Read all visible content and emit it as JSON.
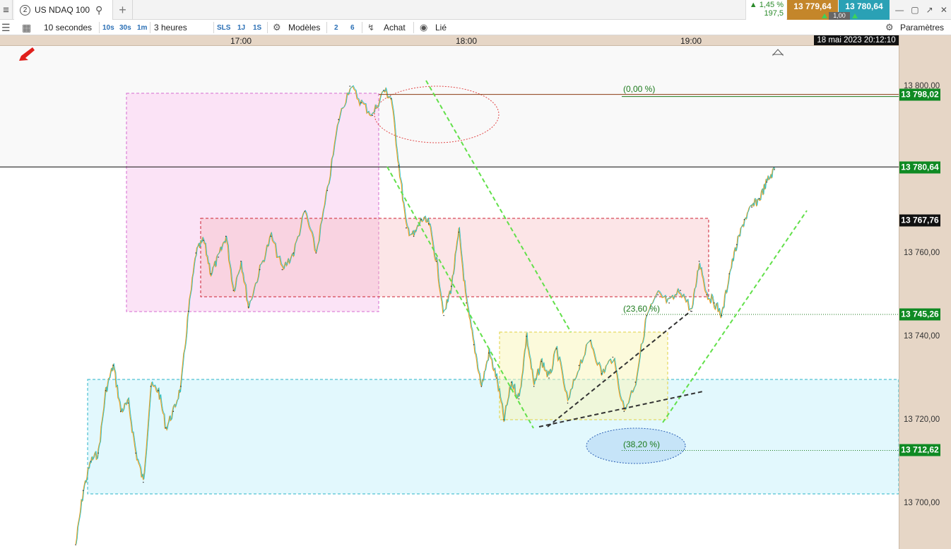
{
  "tab": {
    "badge": "2",
    "instrument": "US NDAQ 100",
    "add": "+"
  },
  "quote": {
    "change_pct": "▲ 1,45 %",
    "change_abs": "197,5",
    "bid": "13 779,64",
    "ask": "13 780,64",
    "spread": "1,00"
  },
  "toolbar": {
    "interval": "10 secondes",
    "i10s": "10s",
    "i30s": "30s",
    "i1m": "1m",
    "period": "3 heures",
    "sls": "SLS",
    "p1j": "1J",
    "p1s": "1S",
    "models": "Modèles",
    "n2": "2",
    "n6": "6",
    "buy": "Achat",
    "linked": "Lié",
    "settings": "Paramètres"
  },
  "time_axis": {
    "current": "18 mai 2023 20:12:10"
  },
  "colors": {
    "candles_up": "#1fc4d4",
    "candles_down": "#f0a020",
    "tag_green": "#0f8a23",
    "axis_bg": "#e6d6c6",
    "bid": "#c4862a",
    "ask": "#2aa1b5"
  },
  "chart_data": {
    "type": "line",
    "title": "US NDAQ 100",
    "xlabel": "",
    "ylabel": "",
    "x_ticks": [
      "17:00",
      "18:00",
      "19:00"
    ],
    "y_ticks": [
      "13 700,00",
      "13 720,00",
      "13 740,00",
      "13 760,00",
      "13 780,00",
      "13 800,00"
    ],
    "ylim": [
      13690,
      13810
    ],
    "series": [
      {
        "x": [
          "16:16",
          "16:18",
          "16:20",
          "16:22",
          "16:24",
          "16:26",
          "16:28",
          "16:30",
          "16:32",
          "16:34",
          "16:36",
          "16:38",
          "16:40",
          "16:42",
          "16:44",
          "16:46",
          "16:48",
          "16:50",
          "16:52",
          "16:54",
          "16:56",
          "16:58",
          "17:00",
          "17:02",
          "17:05",
          "17:08",
          "17:11",
          "17:14",
          "17:17",
          "17:20",
          "17:23",
          "17:26",
          "17:29",
          "17:32",
          "17:35",
          "17:38",
          "17:40",
          "17:42",
          "17:44",
          "17:46",
          "17:48",
          "17:50",
          "17:52",
          "17:54",
          "17:56",
          "17:58",
          "18:00",
          "18:02",
          "18:04",
          "18:06",
          "18:08",
          "18:10",
          "18:12",
          "18:14",
          "18:16",
          "18:18",
          "18:20",
          "18:22",
          "18:24",
          "18:27",
          "18:30",
          "18:33",
          "18:36",
          "18:39",
          "18:42",
          "18:45",
          "18:48",
          "18:51",
          "18:54",
          "18:57",
          "19:00",
          "19:02",
          "19:04",
          "19:06",
          "19:08",
          "19:10",
          "19:12",
          "19:14",
          "19:16",
          "19:18",
          "19:20",
          "19:22"
        ],
        "values": [
          13690,
          13703,
          13710,
          13712,
          13727,
          13733,
          13722,
          13724,
          13712,
          13705,
          13728,
          13727,
          13718,
          13722,
          13728,
          13746,
          13760,
          13763,
          13755,
          13759,
          13764,
          13751,
          13758,
          13747,
          13756,
          13764,
          13756,
          13760,
          13770,
          13760,
          13775,
          13792,
          13800,
          13796,
          13793,
          13799,
          13797,
          13781,
          13766,
          13764,
          13768,
          13767,
          13758,
          13745,
          13752,
          13765,
          13748,
          13738,
          13728,
          13736,
          13730,
          13720,
          13729,
          13725,
          13740,
          13728,
          13734,
          13730,
          13737,
          13724,
          13733,
          13739,
          13731,
          13735,
          13722,
          13729,
          13745,
          13750,
          13748,
          13751,
          13746,
          13758,
          13750,
          13748,
          13745,
          13755,
          13762,
          13768,
          13771,
          13773,
          13777,
          13780
        ]
      }
    ],
    "levels": [
      {
        "value": 13798.02,
        "label": "13 798,02",
        "fib": "(0,00 %)"
      },
      {
        "value": 13780.64,
        "label": "13 780,64"
      },
      {
        "value": 13767.76,
        "label": "13 767,76"
      },
      {
        "value": 13745.26,
        "label": "13 745,26",
        "fib": "(23,60 %)"
      },
      {
        "value": 13712.62,
        "label": "13 712,62",
        "fib": "(38,20 %)"
      }
    ],
    "grid": false,
    "legend": "none"
  }
}
